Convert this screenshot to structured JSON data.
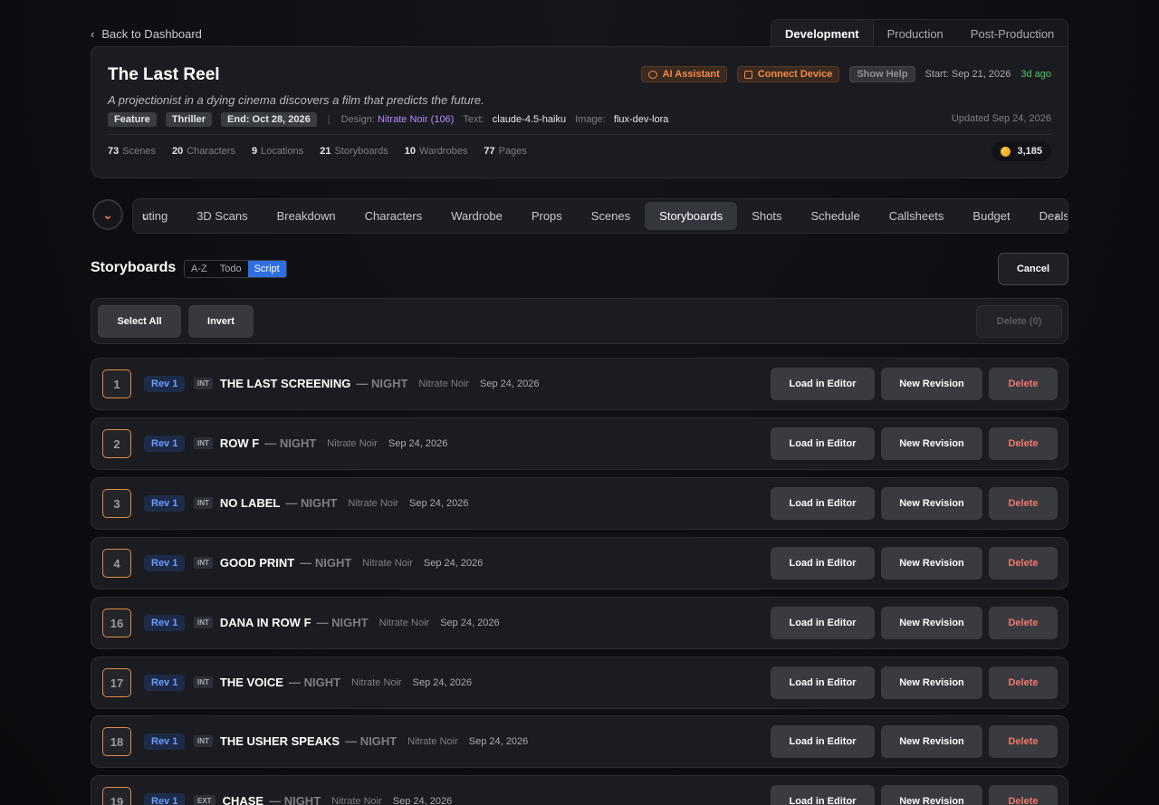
{
  "nav": {
    "back_label": "Back to Dashboard"
  },
  "phase_tabs": [
    {
      "label": "Development",
      "active": true
    },
    {
      "label": "Production",
      "active": false
    },
    {
      "label": "Post-Production",
      "active": false
    }
  ],
  "project": {
    "title": "The Last Reel",
    "tagline": "A projectionist in a dying cinema discovers a film that predicts the future.",
    "ai_assistant_label": "AI Assistant",
    "connect_device_label": "Connect Device",
    "show_help_label": "Show Help",
    "start_label": "Start: Sep 21, 2026",
    "start_ago": "3d ago",
    "tags": [
      "Feature",
      "Thriller",
      "End: Oct 28, 2026"
    ],
    "design_label": "Design:",
    "design_value": "Nitrate Noir (106)",
    "text_label": "Text:",
    "text_value": "claude-4.5-haiku",
    "image_label": "Image:",
    "image_value": "flux-dev-lora",
    "updated": "Updated Sep 24, 2026",
    "stats": [
      {
        "count": "73",
        "label": "Scenes"
      },
      {
        "count": "20",
        "label": "Characters"
      },
      {
        "count": "9",
        "label": "Locations"
      },
      {
        "count": "21",
        "label": "Storyboards"
      },
      {
        "count": "10",
        "label": "Wardrobes"
      },
      {
        "count": "77",
        "label": "Pages"
      }
    ],
    "coins": "3,185"
  },
  "section_tabs": [
    "uting",
    "3D Scans",
    "Breakdown",
    "Characters",
    "Wardrobe",
    "Props",
    "Scenes",
    "Storyboards",
    "Shots",
    "Schedule",
    "Callsheets",
    "Budget",
    "Deals"
  ],
  "section_active": "Storyboards",
  "storyboards": {
    "title": "Storyboards",
    "sort_options": [
      "A-Z",
      "Todo",
      "Script"
    ],
    "sort_active": "Script",
    "cancel_label": "Cancel",
    "select_all_label": "Select All",
    "invert_label": "Invert",
    "delete_selected_label": "Delete (0)",
    "load_label": "Load in Editor",
    "new_revision_label": "New Revision",
    "delete_label": "Delete",
    "rows": [
      {
        "num": "1",
        "rev": "Rev 1",
        "ie": "INT",
        "slug": "THE LAST SCREENING",
        "tod": "— NIGHT",
        "style": "Nitrate Noir",
        "date": "Sep 24, 2026"
      },
      {
        "num": "2",
        "rev": "Rev 1",
        "ie": "INT",
        "slug": "ROW F",
        "tod": "— NIGHT",
        "style": "Nitrate Noir",
        "date": "Sep 24, 2026"
      },
      {
        "num": "3",
        "rev": "Rev 1",
        "ie": "INT",
        "slug": "NO LABEL",
        "tod": "— NIGHT",
        "style": "Nitrate Noir",
        "date": "Sep 24, 2026"
      },
      {
        "num": "4",
        "rev": "Rev 1",
        "ie": "INT",
        "slug": "GOOD PRINT",
        "tod": "— NIGHT",
        "style": "Nitrate Noir",
        "date": "Sep 24, 2026"
      },
      {
        "num": "16",
        "rev": "Rev 1",
        "ie": "INT",
        "slug": "DANA IN ROW F",
        "tod": "— NIGHT",
        "style": "Nitrate Noir",
        "date": "Sep 24, 2026"
      },
      {
        "num": "17",
        "rev": "Rev 1",
        "ie": "INT",
        "slug": "THE VOICE",
        "tod": "— NIGHT",
        "style": "Nitrate Noir",
        "date": "Sep 24, 2026"
      },
      {
        "num": "18",
        "rev": "Rev 1",
        "ie": "INT",
        "slug": "THE USHER SPEAKS",
        "tod": "— NIGHT",
        "style": "Nitrate Noir",
        "date": "Sep 24, 2026"
      },
      {
        "num": "19",
        "rev": "Rev 1",
        "ie": "EXT",
        "slug": "CHASE",
        "tod": "— NIGHT",
        "style": "Nitrate Noir",
        "date": "Sep 24, 2026"
      }
    ]
  },
  "colors": {
    "accent_orange": "#f08a4b",
    "accent_blue": "#2f6fe0",
    "danger": "#f0776a",
    "success": "#4cc46a",
    "purple": "#b28dff"
  }
}
